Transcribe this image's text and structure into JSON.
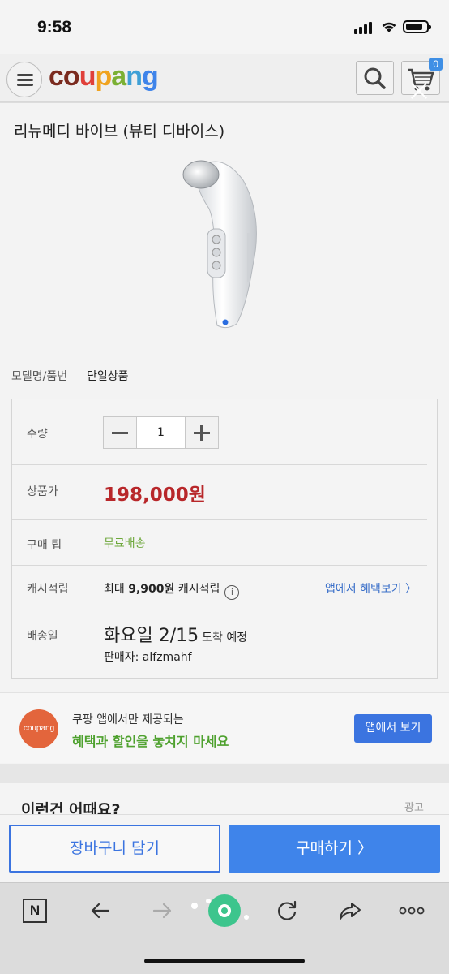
{
  "status_bar": {
    "time": "9:58"
  },
  "header": {
    "logo_letters": [
      "c",
      "o",
      "u",
      "p",
      "a",
      "n",
      "g"
    ],
    "logo_colors": [
      "#7a2a1e",
      "#7a2a1e",
      "#e0403a",
      "#f0a31f",
      "#7bb034",
      "#3fa0d6",
      "#3f84ea"
    ],
    "cart_count": "0"
  },
  "product": {
    "title": "리뉴메디 바이브 (뷰티 디바이스)",
    "model_label": "모델명/품번",
    "model_value": "단일상품"
  },
  "info": {
    "quantity_label": "수량",
    "quantity_value": "1",
    "price_label": "상품가",
    "price": "198,000원",
    "tip_label": "구매 팁",
    "tip_value": "무료배송",
    "cash_label": "캐시적립",
    "cash_prefix": "최대",
    "cash_amount": "9,900원",
    "cash_suffix": "캐시적립",
    "cash_link": "앱에서 혜택보기 〉",
    "delivery_label": "배송일",
    "delivery_date": "화요일 2/15",
    "delivery_suffix": "도착 예정",
    "seller": "판매자: alfzmahf"
  },
  "promo": {
    "logo_text": "coupang",
    "line1": "쿠팡 앱에서만 제공되는",
    "line2": "혜택과 할인을 놓치지 마세요",
    "button": "앱에서 보기"
  },
  "suggest": {
    "title": "이런건 어때요?",
    "ad_label": "광고"
  },
  "actions": {
    "add_to_cart": "장바구니 담기",
    "buy": "구매하기 〉"
  },
  "browser": {
    "n_label": "N"
  }
}
